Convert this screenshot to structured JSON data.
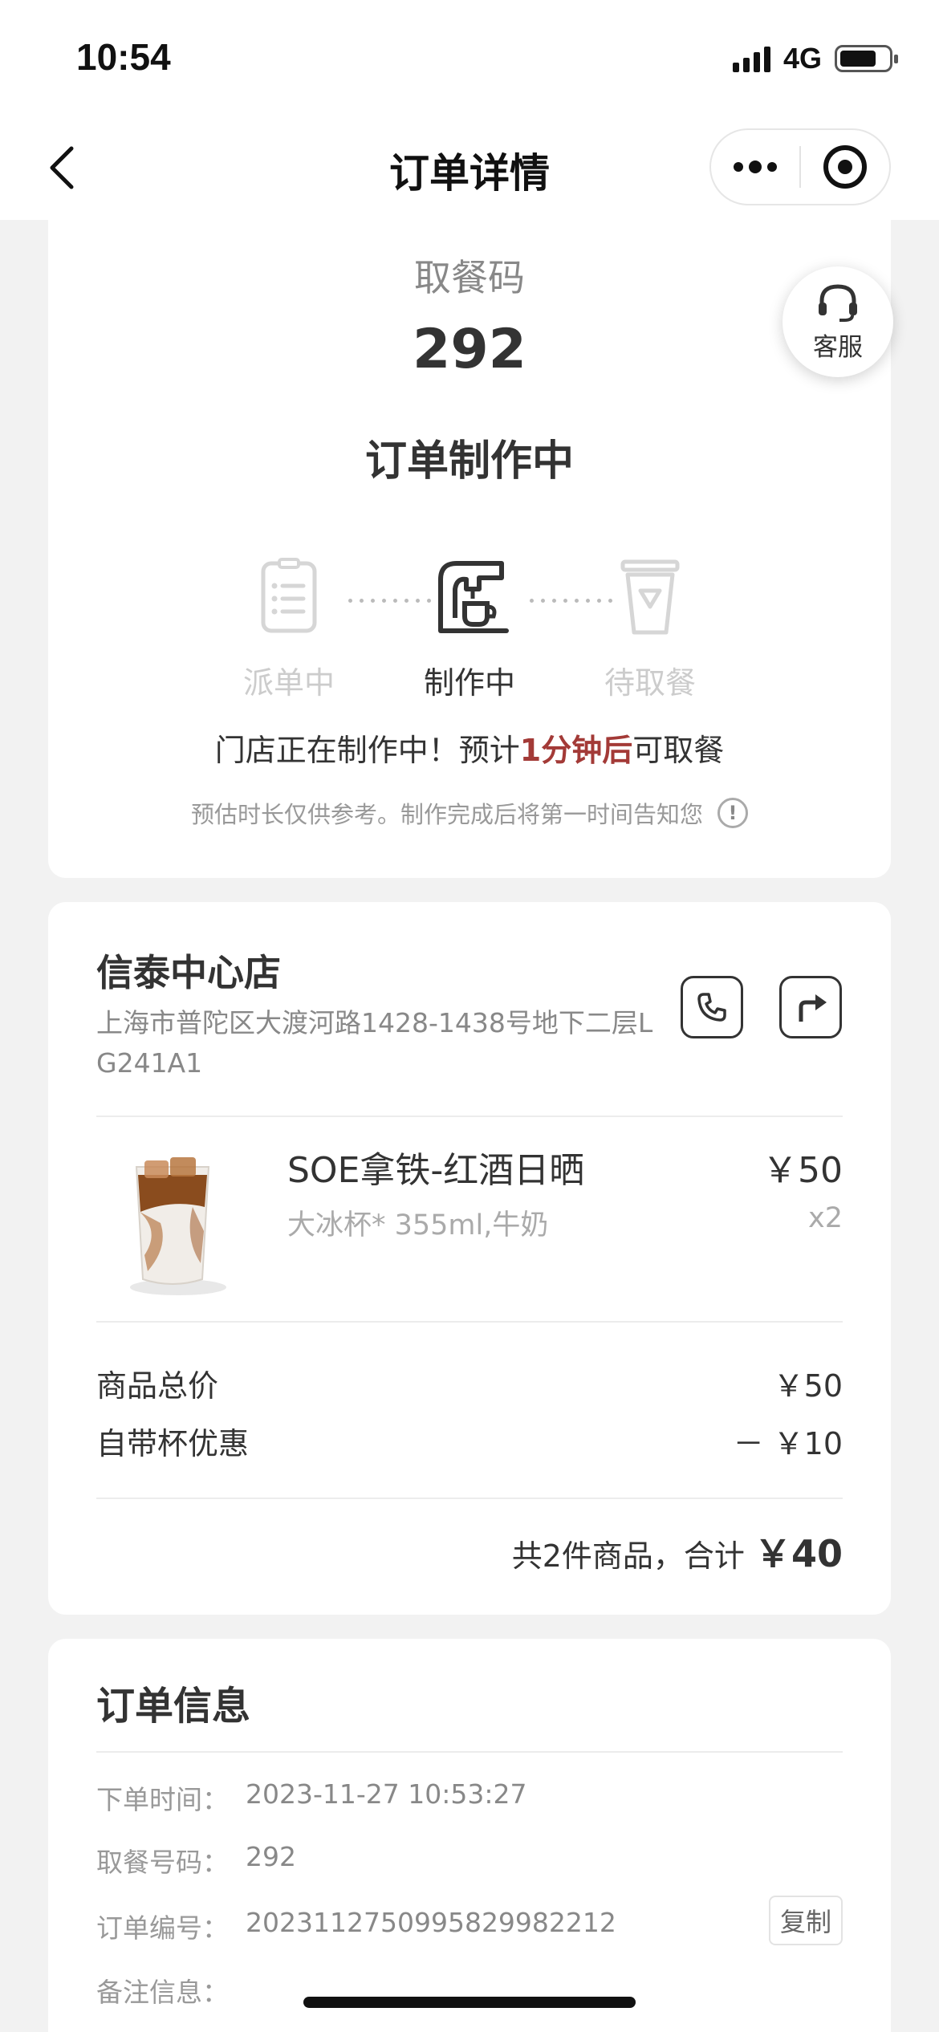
{
  "status_bar": {
    "time": "10:54",
    "network": "4G",
    "battery_percent": 75
  },
  "nav": {
    "title": "订单详情",
    "more_icon": "more-dots-icon",
    "close_icon": "target-circle-icon"
  },
  "pickup": {
    "label": "取餐码",
    "code": "292",
    "status": "订单制作中"
  },
  "steps": [
    {
      "label": "派单中",
      "icon": "order-list-icon",
      "active": false
    },
    {
      "label": "制作中",
      "icon": "coffee-machine-icon",
      "active": true
    },
    {
      "label": "待取餐",
      "icon": "cup-icon",
      "active": false
    }
  ],
  "eta": {
    "before": "门店正在制作中！预计",
    "highlight": "1分钟后",
    "after": "可取餐",
    "highlight_color": "#a33a37"
  },
  "eta_note": "预估时长仅供参考。制作完成后将第一时间告知您",
  "service": {
    "label": "客服",
    "icon": "headset-icon"
  },
  "store": {
    "name": "信泰中心店",
    "address": "上海市普陀区大渡河路1428-1438号地下二层LG241A1",
    "phone_icon": "phone-icon",
    "nav_icon": "navigation-arrow-icon"
  },
  "product": {
    "name": "SOE拿铁-红酒日晒",
    "spec": "大冰杯* 355ml,牛奶",
    "price": "￥50",
    "qty": "x2"
  },
  "price_rows": [
    {
      "label": "商品总价",
      "value": "￥50"
    },
    {
      "label": "自带杯优惠",
      "value": "－ ￥10"
    }
  ],
  "total": {
    "prefix": "共2件商品，合计",
    "amount": "￥40"
  },
  "order_info": {
    "title": "订单信息",
    "rows": [
      {
        "label": "下单时间：",
        "value": "2023-11-27 10:53:27"
      },
      {
        "label": "取餐号码：",
        "value": "292"
      },
      {
        "label": "订单编号：",
        "value": "202311275099582998221​2"
      },
      {
        "label": "备注信息：",
        "value": ""
      }
    ],
    "copy_label": "复制"
  }
}
